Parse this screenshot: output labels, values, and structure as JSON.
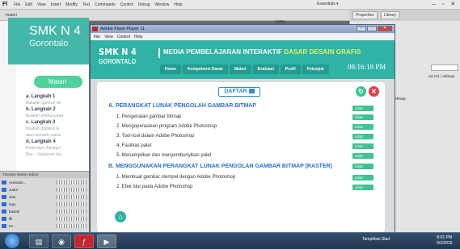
{
  "ide": {
    "logo": "Fl",
    "menu": [
      "File",
      "Edit",
      "View",
      "Insert",
      "Modify",
      "Text",
      "Commands",
      "Control",
      "Debug",
      "Window",
      "Help"
    ],
    "doc_tab": "materi",
    "essentials": "Essentials ▾",
    "zoom": "100%",
    "panel_tabs": [
      "Properties",
      "Library"
    ],
    "stage": {
      "school_line1": "SMK N 4",
      "school_line2": "Gorontalo",
      "materi_button": "Materi",
      "lessons": [
        {
          "title": "a. Langkah 1",
          "sub": "Bukalah gambar de"
        },
        {
          "title": "b. Langkah 2",
          "sub": "Buatlah seleksi pada"
        },
        {
          "title": "c. Langkah 3",
          "sub": "Buatlah duplikat la"
        },
        {
          "title": "",
          "sub": "atau menarik nama"
        },
        {
          "title": "d. Langkah 4",
          "sub": "Pada layer Backgro"
        },
        {
          "title": "",
          "sub": "Blur -- Gaussian blu"
        }
      ]
    },
    "timeline_tabs": "Timeline   Motion Editor",
    "layers": [
      "Animatio...",
      "Judul",
      "Jam",
      "logo",
      "bawah",
      "fill",
      "txt..."
    ],
    "right_list": "worldmap",
    "right_mini": "ad 241 | adlarge"
  },
  "flash_player": {
    "title": "Adobe Flash Player 11",
    "menu": [
      "File",
      "View",
      "Control",
      "Help"
    ],
    "app": {
      "school_line1": "SMK N 4",
      "school_line2": "GORONTALO",
      "title_main": "MEDIA PEMBELAJARAN INTERAKTIF",
      "title_highlight": "DASAR DESAIN GRAFIS",
      "nav": [
        "Home",
        "Kompetensi Dasar",
        "Materi",
        "Evaluasi",
        "Profil",
        "Petunjuk"
      ],
      "clock": "08:16:18 PM",
      "daftar_label": "DAFTAR",
      "sections": [
        {
          "heading": "A. PERANGKAT LUNAK PENGOLAH GAMBAR BITMAP",
          "items": [
            "1. Pengenalan gambar bitmap",
            "2. Mengoperasikan program Adobe Photoshop",
            "3. Tool-tool dalam Adobe Photoshop",
            "4. Fasilitas palet",
            "5. Menampilkan dan menyembunyikan palet"
          ]
        },
        {
          "heading": "B. MENGGUNAKAN PERANGKAT LUNAK PENGOLAH GAMBAR BITMAP (RASTER)",
          "items": [
            "1. Membuat gambar stempel dengan Adobe Photoshop",
            "2. Efek blur pada Adobe Photoshop"
          ]
        }
      ],
      "go_label": "Lihat"
    }
  },
  "taskbar": {
    "tray_text": "Tampilkan Start",
    "time": "8:01 PM",
    "date": "9/2/2019"
  }
}
